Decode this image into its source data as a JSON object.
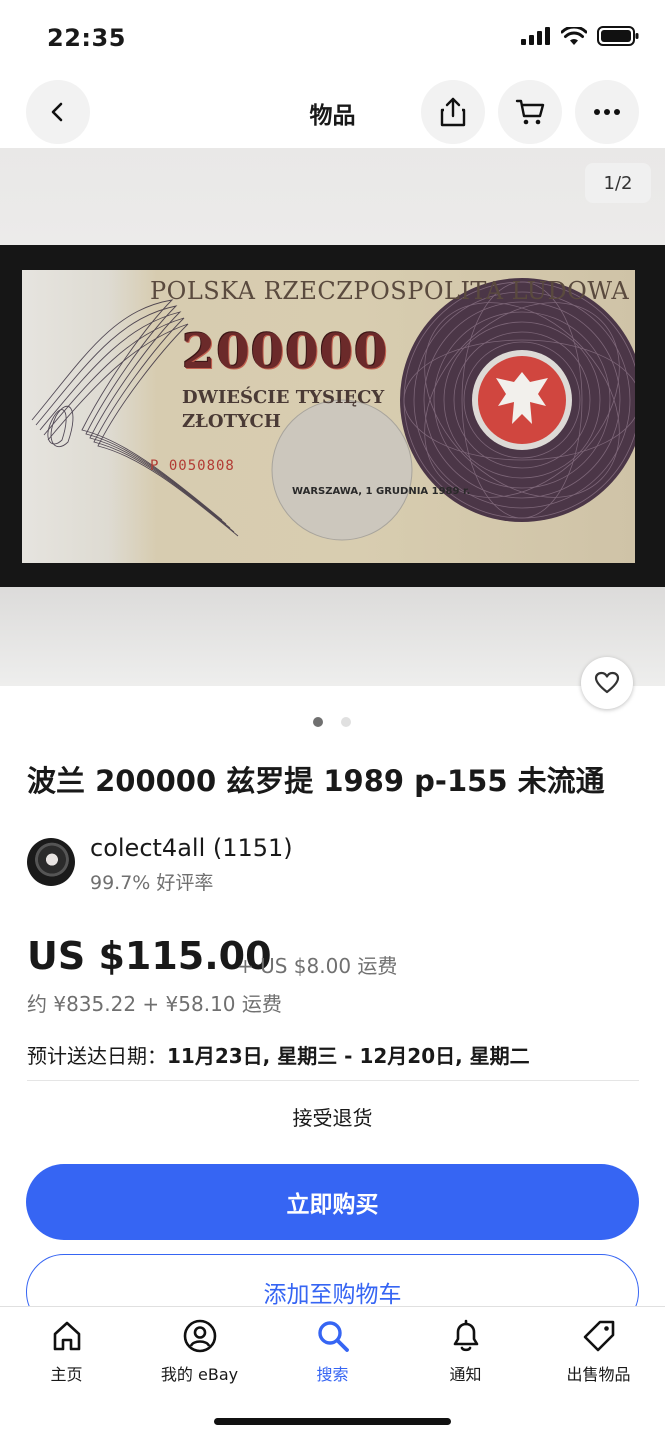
{
  "status_bar": {
    "time": "22:35"
  },
  "header": {
    "title": "物品"
  },
  "gallery": {
    "counter": "1/2",
    "page_dots": {
      "count": 2,
      "active_index": 0
    },
    "banknote": {
      "header": "POLSKA RZECZPOSPOLITA LUDOWA",
      "value": "200000",
      "words_line1": "DWIEŚCIE TYSIĘCY",
      "words_line2": "ZŁOTYCH",
      "serial": "P 0050808",
      "city_date": "WARSZAWA, 1 GRUDNIA 1989 r."
    }
  },
  "listing": {
    "title": "波兰 200000 兹罗提 1989 p-155 未流通",
    "seller": {
      "name": "colect4all (1151)",
      "feedback": "99.7% 好评率"
    },
    "price": "US $115.00",
    "shipping": "+ US $8.00 运费",
    "approx": "约 ¥835.22 + ¥58.10 运费",
    "delivery_label": "预计送达日期：",
    "delivery_dates": "11月23日, 星期三 - 12月20日, 星期二",
    "returns": "接受退货"
  },
  "actions": {
    "buy_now": "立即购买",
    "add_to_cart": "添加至购物车"
  },
  "tabbar": {
    "items": [
      {
        "label": "主页",
        "icon": "home-icon"
      },
      {
        "label": "我的 eBay",
        "icon": "account-icon"
      },
      {
        "label": "搜索",
        "icon": "search-icon",
        "active": true
      },
      {
        "label": "通知",
        "icon": "bell-icon"
      },
      {
        "label": "出售物品",
        "icon": "tag-icon"
      }
    ]
  },
  "colors": {
    "accent": "#3665f3",
    "text": "#191919",
    "muted": "#707070"
  }
}
